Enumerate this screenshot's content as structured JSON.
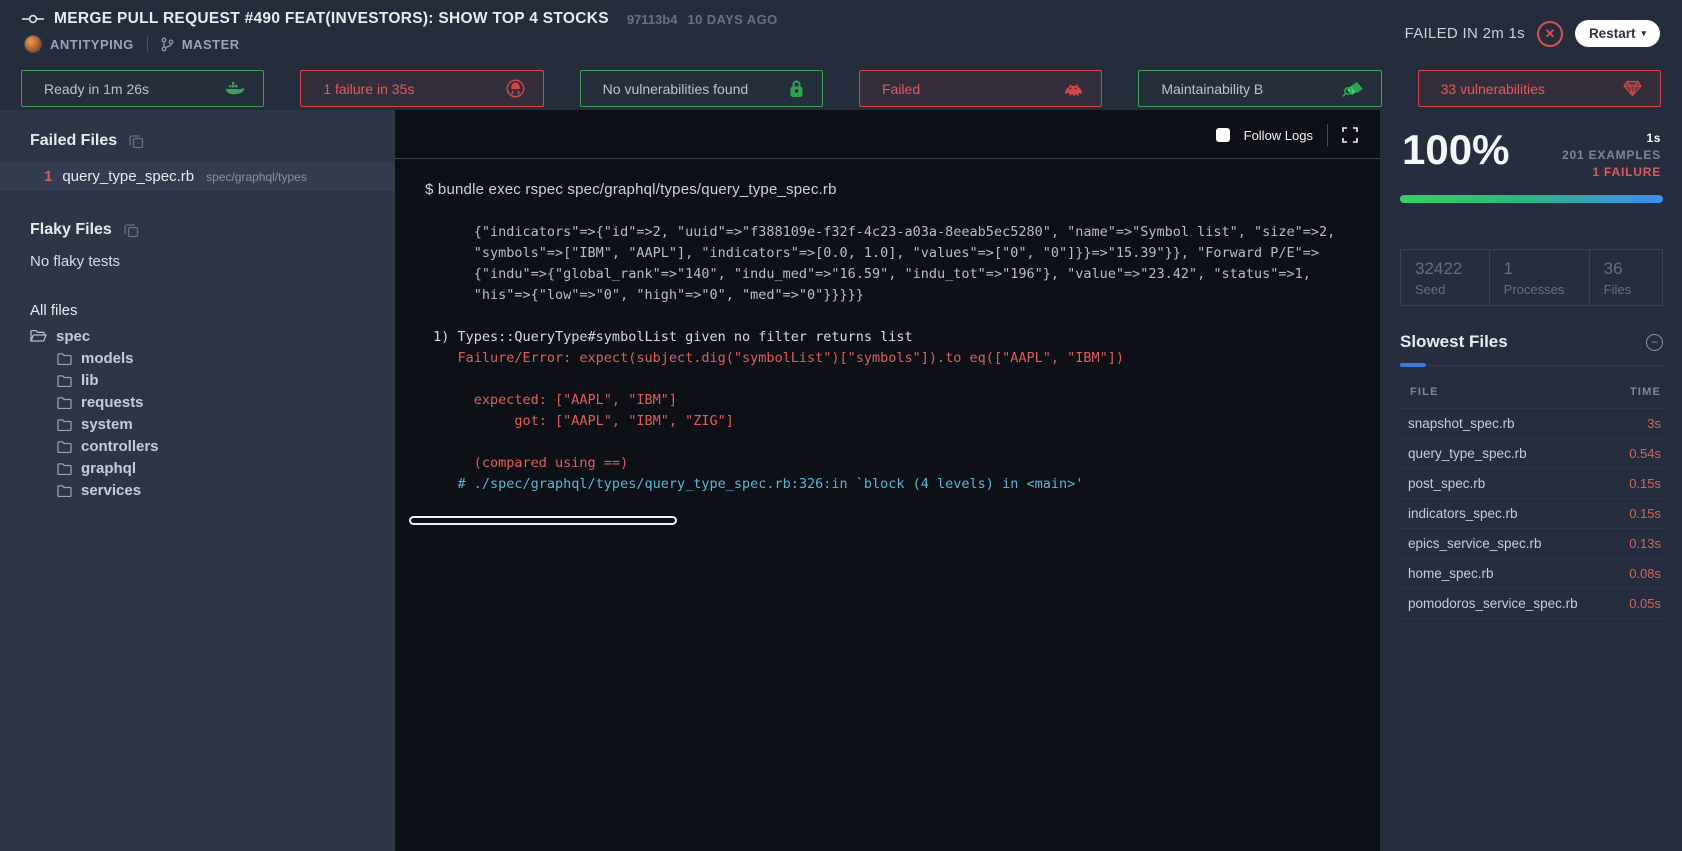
{
  "header": {
    "title": "MERGE PULL REQUEST #490 FEAT(INVESTORS): SHOW TOP 4 STOCKS",
    "commit_hash": "97113b4",
    "commit_age": "10 DAYS AGO",
    "author": "ANTITYPING",
    "branch": "MASTER",
    "status_text": "FAILED IN 2m 1s",
    "restart_label": "Restart",
    "restart_caret": "▾",
    "fail_glyph": "✕",
    "icons": [
      "git-commit-icon",
      "git-branch-icon",
      "failed-circle-icon"
    ]
  },
  "badges": [
    {
      "label": "Ready in 1m 26s",
      "status": "success",
      "icon": "docker-icon"
    },
    {
      "label": "1 failure in 35s",
      "status": "failed",
      "icon": "rubocop-icon"
    },
    {
      "label": "No vulnerabilities found",
      "status": "success",
      "icon": "lock-icon"
    },
    {
      "label": "Failed",
      "status": "failed",
      "icon": "hound-icon"
    },
    {
      "label": "Maintainability B",
      "status": "success",
      "icon": "codeclimate-icon"
    },
    {
      "label": "33 vulnerabilities",
      "status": "failed",
      "icon": "ruby-gem-icon"
    }
  ],
  "colors": {
    "success_border": "#3f9e58",
    "failed_border": "#cf4747",
    "failure_red": "#dd5b5b",
    "trace_cyan": "#58b7d4",
    "progress_gradient_start": "#35d060",
    "progress_gradient_end": "#3f8cf3",
    "terminal_bg": "#0d1016",
    "left_panel_bg": "#2d3547",
    "page_bg": "#252c3b"
  },
  "sidebar": {
    "failed_files": {
      "heading": "Failed Files",
      "items": [
        {
          "count": "1",
          "name": "query_type_spec.rb",
          "path": "spec/graphql/types"
        }
      ]
    },
    "flaky_files": {
      "heading": "Flaky Files",
      "empty_text": "No flaky tests"
    },
    "all_files": {
      "heading": "All files",
      "root": "spec",
      "folders": [
        "models",
        "lib",
        "requests",
        "system",
        "controllers",
        "graphql",
        "services"
      ]
    }
  },
  "terminal": {
    "follow_logs_label": "Follow Logs",
    "command": "$ bundle exec rspec spec/graphql/types/query_type_spec.rb",
    "lines": [
      {
        "text": "      {\"indicators\"=>{\"id\"=>2, \"uuid\"=>\"f388109e-f32f-4c23-a03a-8eeab5ec5280\", \"name\"=>\"Symbol list\", \"size\"=>2,",
        "color": "plain"
      },
      {
        "text": "      \"symbols\"=>[\"IBM\", \"AAPL\"], \"indicators\"=>[0.0, 1.0], \"values\"=>[\"0\", \"0\"]}}=>\"15.39\"}}, \"Forward P/E\"=>",
        "color": "plain"
      },
      {
        "text": "      {\"indu\"=>{\"global_rank\"=>\"140\", \"indu_med\"=>\"16.59\", \"indu_tot\"=>\"196\"}, \"value\"=>\"23.42\", \"status\"=>1,",
        "color": "plain"
      },
      {
        "text": "      \"his\"=>{\"low\"=>\"0\", \"high\"=>\"0\", \"med\"=>\"0\"}}}}}",
        "color": "plain"
      },
      {
        "text": " 1) Types::QueryType#symbolList given no filter returns list",
        "color": "bright"
      },
      {
        "text": "    Failure/Error: expect(subject.dig(\"symbolList\")[\"symbols\"]).to eq([\"AAPL\", \"IBM\"])",
        "color": "red"
      },
      {
        "text": "      expected: [\"AAPL\", \"IBM\"]",
        "color": "red"
      },
      {
        "text": "           got: [\"AAPL\", \"IBM\", \"ZIG\"]",
        "color": "red"
      },
      {
        "text": "      (compared using ==)",
        "color": "red"
      },
      {
        "text": "    # ./spec/graphql/types/query_type_spec.rb:326:in `block (4 levels) in <main>'",
        "color": "cyan"
      }
    ]
  },
  "summary": {
    "percent": "100%",
    "duration": "1s",
    "examples": "201 EXAMPLES",
    "failures": "1 FAILURE",
    "stats": [
      {
        "value": "32422",
        "label": "Seed"
      },
      {
        "value": "1",
        "label": "Processes"
      },
      {
        "value": "36",
        "label": "Files"
      }
    ],
    "slowest": {
      "heading": "Slowest Files",
      "col_file": "FILE",
      "col_time": "TIME",
      "rows": [
        {
          "file": "snapshot_spec.rb",
          "time": "3s"
        },
        {
          "file": "query_type_spec.rb",
          "time": "0.54s"
        },
        {
          "file": "post_spec.rb",
          "time": "0.15s"
        },
        {
          "file": "indicators_spec.rb",
          "time": "0.15s"
        },
        {
          "file": "epics_service_spec.rb",
          "time": "0.13s"
        },
        {
          "file": "home_spec.rb",
          "time": "0.08s"
        },
        {
          "file": "pomodoros_service_spec.rb",
          "time": "0.05s"
        }
      ]
    }
  }
}
